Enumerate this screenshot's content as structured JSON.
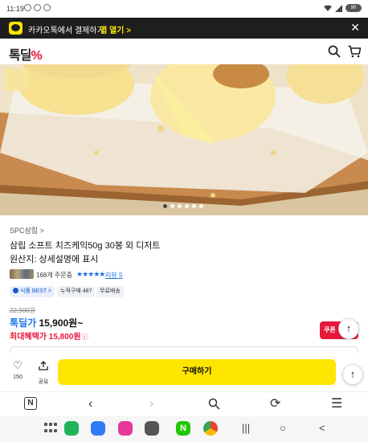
{
  "status": {
    "time": "11:19",
    "battery": "90"
  },
  "banner": {
    "text": "카카오톡에서 결제하기",
    "open_label": "앱 열기 >"
  },
  "header": {
    "logo_main": "톡딜",
    "logo_accent": "%"
  },
  "carousel": {
    "total": 6,
    "current": 1
  },
  "product": {
    "brand": "SPC삼립 >",
    "name": "삼립 소프트 치즈케익50g 30봉 외 디저트",
    "origin": "원산지: 상세설명에 표시",
    "orders": "168개 주문중",
    "stars": "★★★★★",
    "rating": 5,
    "review_label": "리뷰 5",
    "badges": {
      "food": "식품 BEST >",
      "cumulative": "누적구매 487",
      "shipping": "무료배송"
    },
    "original_price": "22,900원",
    "price_label": "톡딜가",
    "price": "15,900원~",
    "max_benefit": "최대혜택가 15,800원",
    "max_benefit_info": "ⓘ",
    "coupon": "쿠폰"
  },
  "actions": {
    "like_count": "150",
    "share_label": "공유",
    "buy_label": "구매하기"
  },
  "icons": {
    "up": "↑",
    "heart": "♡",
    "close": "✕",
    "back": "‹",
    "forward": "›",
    "refresh": "⟳",
    "menu": "☰",
    "recent": "|||",
    "home": "○",
    "nav_back": "<"
  },
  "colors": {
    "kakao_yellow": "#FEE500",
    "brand_red": "#E8173C",
    "link_blue": "#1A73E8"
  }
}
